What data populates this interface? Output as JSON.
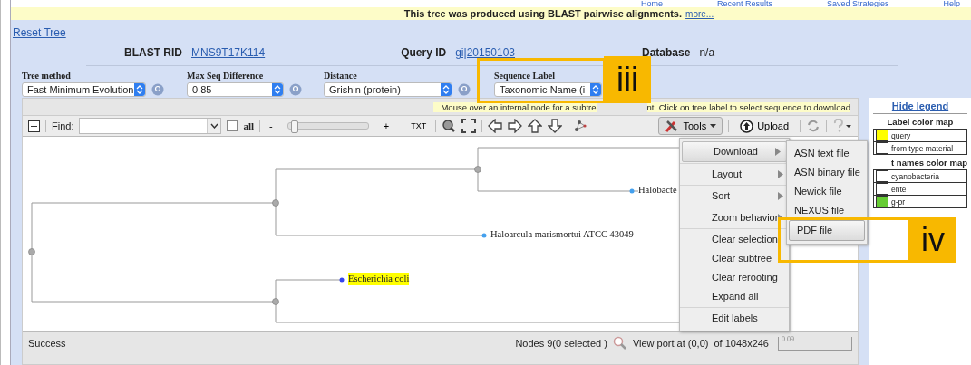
{
  "nav_links": [
    "Home",
    "Recent Results",
    "Saved Strategies",
    "Help"
  ],
  "banner": {
    "text": "This tree was produced using BLAST pairwise alignments.",
    "link": "more..."
  },
  "reset_link": "Reset Tree",
  "info": [
    {
      "label": "BLAST RID",
      "value": "MNS9T17K114",
      "kind": "link"
    },
    {
      "label": "Query ID",
      "value": "gi|20150103",
      "kind": "link"
    },
    {
      "label": "Database",
      "value": "n/a",
      "kind": "text"
    }
  ],
  "controls": [
    {
      "label": "Tree method",
      "value": "Fast Minimum Evolution",
      "help": true
    },
    {
      "label": "Max Seq Difference",
      "value": "0.85",
      "help": true
    },
    {
      "label": "Distance",
      "value": "Grishin (protein)",
      "help": true
    },
    {
      "label": "Sequence Label",
      "value": "Taxonomic Name (i",
      "help": false
    }
  ],
  "hint": "Mouse over an internal node for a subtre",
  "hint_rest": "nt. Click on tree label to select sequence to download",
  "toolbar": {
    "find_label": "Find:",
    "all_label": "all",
    "all_checked": false,
    "minus": "-",
    "plus": "+",
    "zoom": {
      "level": 0.04
    },
    "txt": "TXT",
    "tools": "Tools",
    "upload": "Upload"
  },
  "tree": {
    "leaves": [
      {
        "label": "Halobacte",
        "highlighted": false
      },
      {
        "label": "Haloarcula marismortui ATCC 43049",
        "highlighted": false
      },
      {
        "label": "Escherichia coli",
        "highlighted": true
      }
    ]
  },
  "status": {
    "text": "Success",
    "nodes": "Nodes 9(0 selected )",
    "viewport": "View port at (0,0)",
    "size": "of 1048x246",
    "scale": "0.09"
  },
  "legend": {
    "hide_link": "Hide legend",
    "label_title": "Label color map",
    "label_rows": [
      {
        "name": "query",
        "color": "#ffff00"
      },
      {
        "name": "from type material",
        "color": "#ffffff"
      }
    ],
    "names_title": "t names color map",
    "names_rows": [
      {
        "name": "cyanobacteria",
        "color": "#ffffff"
      },
      {
        "name": "ente",
        "color": "#ffffff"
      },
      {
        "name": "g-pr",
        "color": "#66cc33"
      }
    ]
  },
  "menu": {
    "groups": [
      [
        {
          "label": "Download",
          "submenu": true,
          "selected": true
        }
      ],
      [
        {
          "label": "Layout",
          "submenu": true,
          "selected": false
        }
      ],
      [
        {
          "label": "Sort",
          "submenu": true,
          "selected": false
        }
      ],
      [
        {
          "label": "Zoom behavior",
          "submenu": true,
          "selected": false
        }
      ],
      [
        {
          "label": "Clear selection",
          "submenu": false,
          "selected": false
        },
        {
          "label": "Clear subtree",
          "submenu": false,
          "selected": false
        },
        {
          "label": "Clear rerooting",
          "submenu": false,
          "selected": false
        },
        {
          "label": "Expand all",
          "submenu": false,
          "selected": false
        }
      ],
      [
        {
          "label": "Edit labels",
          "submenu": false,
          "selected": false
        }
      ]
    ]
  },
  "submenu": [
    {
      "label": "ASN text file",
      "selected": false
    },
    {
      "label": "ASN binary file",
      "selected": false
    },
    {
      "label": "Newick file",
      "selected": false
    },
    {
      "label": "NEXUS file",
      "selected": false
    },
    {
      "label": "PDF file",
      "selected": true
    }
  ],
  "callouts": [
    {
      "label": "iii"
    },
    {
      "label": "iv"
    }
  ]
}
